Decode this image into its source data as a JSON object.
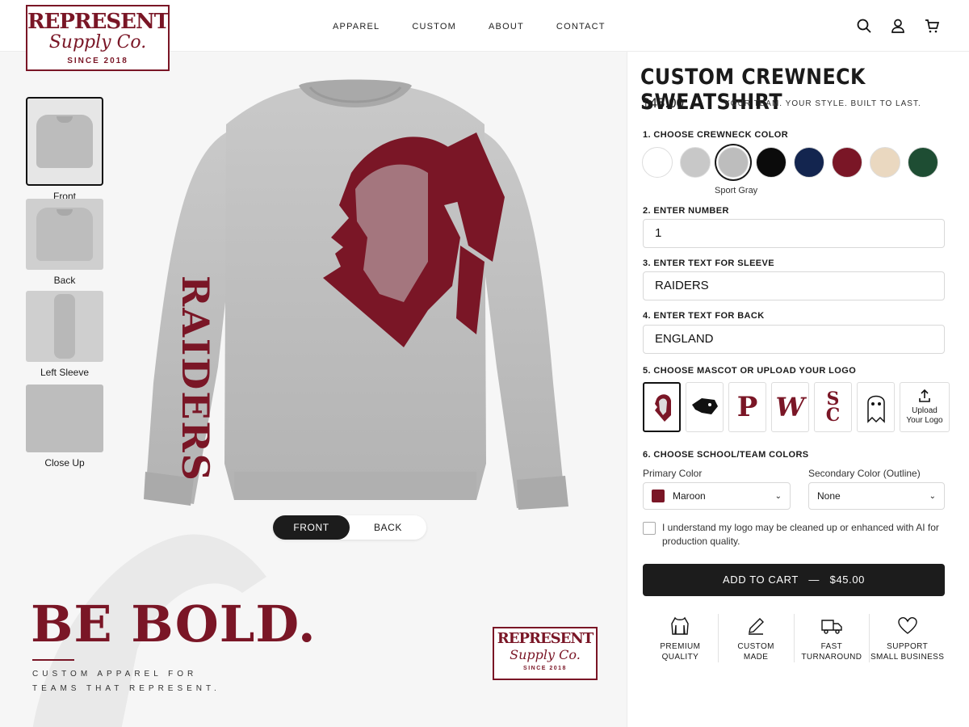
{
  "brand": {
    "name": "REPRESENT",
    "script": "Supply Co.",
    "since": "SINCE 2018"
  },
  "nav": {
    "items": [
      "APPAREL",
      "CUSTOM",
      "ABOUT",
      "CONTACT"
    ]
  },
  "header_icons": [
    "search-icon",
    "user-icon",
    "cart-icon"
  ],
  "gallery": {
    "thumbs": [
      {
        "label": "Front",
        "selected": true
      },
      {
        "label": "Back"
      },
      {
        "label": "Left Sleeve"
      },
      {
        "label": "Close Up"
      }
    ],
    "sleeve_text": "RAIDERS",
    "view_toggle": {
      "front": "FRONT",
      "back": "BACK",
      "active": "FRONT"
    }
  },
  "promo": {
    "headline": "BE BOLD.",
    "tagline_1": "CUSTOM APPAREL FOR",
    "tagline_2": "TEAMS THAT REPRESENT."
  },
  "product": {
    "title": "CUSTOM CREWNECK SWEATSHIRT",
    "price": "$45.00",
    "slogan": "YOUR TEAM. YOUR STYLE. BUILT TO LAST."
  },
  "steps": {
    "color": "1. CHOOSE CREWNECK COLOR",
    "number": "2. ENTER NUMBER",
    "sleeve": "3. ENTER TEXT FOR SLEEVE",
    "back": "4. ENTER TEXT FOR BACK",
    "mascot": "5. CHOOSE MASCOT OR UPLOAD YOUR LOGO",
    "team_colors": "6. CHOOSE SCHOOL/TEAM COLORS"
  },
  "colors": {
    "swatches": [
      "#ffffff",
      "#c8c8c8",
      "#bdbdbd",
      "#0b0b0b",
      "#13254f",
      "#7a1626",
      "#ead8c0",
      "#1e4d33"
    ],
    "selected_name": "Sport Gray"
  },
  "inputs": {
    "number": "1",
    "sleeve": "RAIDERS",
    "back": "ENGLAND"
  },
  "mascots": {
    "items": [
      "chief",
      "panther",
      "P",
      "W",
      "SC",
      "ghost"
    ],
    "upload_label_1": "Upload",
    "upload_label_2": "Your Logo"
  },
  "team_colors": {
    "primary_label": "Primary Color",
    "primary_value": "Maroon",
    "secondary_label": "Secondary Color (Outline)",
    "secondary_value": "None"
  },
  "consent": "I understand my logo may be cleaned up or enhanced with AI for production quality.",
  "cart": {
    "label": "ADD TO CART",
    "sep": "—",
    "price": "$45.00"
  },
  "features": [
    {
      "line1": "PREMIUM",
      "line2": "QUALITY"
    },
    {
      "line1": "CUSTOM",
      "line2": "MADE"
    },
    {
      "line1": "FAST",
      "line2": "TURNAROUND"
    },
    {
      "line1": "SUPPORT",
      "line2": "SMALL BUSINESS"
    }
  ]
}
